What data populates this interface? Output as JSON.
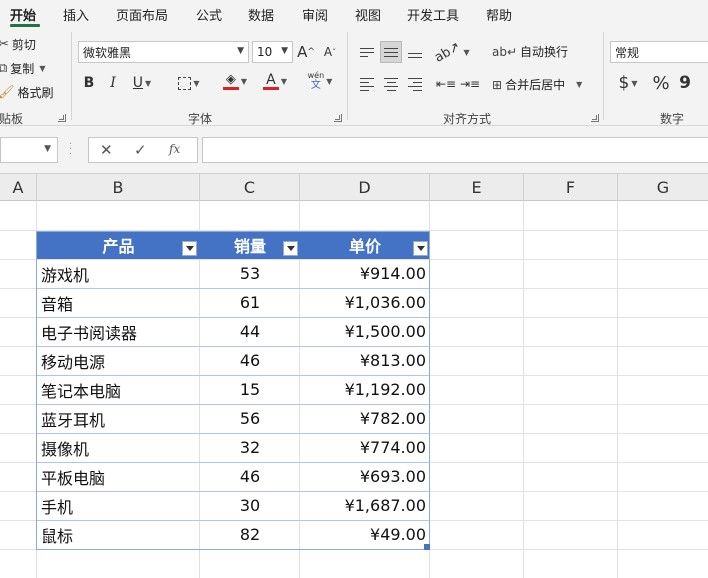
{
  "ribbon_tabs": [
    "开始",
    "插入",
    "页面布局",
    "公式",
    "数据",
    "审阅",
    "视图",
    "开发工具",
    "帮助"
  ],
  "clipboard": {
    "cut": "剪切",
    "copy": "复制",
    "format_painter": "格式刷",
    "group_label": "剪贴板",
    "visible_group_label": "贴板"
  },
  "font": {
    "name": "微软雅黑",
    "size": "10",
    "increase_label": "A",
    "decrease_label": "A",
    "bold": "B",
    "italic": "I",
    "underline": "U",
    "font_color_label": "A",
    "phonetic_top": "wén",
    "phonetic_bottom": "文",
    "group_label": "字体"
  },
  "alignment": {
    "wrap_text": "自动换行",
    "merge_center": "合并后居中",
    "group_label": "对齐方式"
  },
  "number": {
    "format": "常规",
    "currency": "$",
    "percent": "%",
    "comma": "9",
    "group_label": "数字"
  },
  "formula_bar": {
    "fx": "fx",
    "cancel": "✕",
    "enter": "✓"
  },
  "columns": [
    "A",
    "B",
    "C",
    "D",
    "E",
    "F",
    "G"
  ],
  "table": {
    "headers": [
      "产品",
      "销量",
      "单价"
    ],
    "rows": [
      {
        "product": "游戏机",
        "sales": "53",
        "price": "¥914.00"
      },
      {
        "product": "音箱",
        "sales": "61",
        "price": "¥1,036.00"
      },
      {
        "product": "电子书阅读器",
        "sales": "44",
        "price": "¥1,500.00"
      },
      {
        "product": "移动电源",
        "sales": "46",
        "price": "¥813.00"
      },
      {
        "product": "笔记本电脑",
        "sales": "15",
        "price": "¥1,192.00"
      },
      {
        "product": "蓝牙耳机",
        "sales": "56",
        "price": "¥782.00"
      },
      {
        "product": "摄像机",
        "sales": "32",
        "price": "¥774.00"
      },
      {
        "product": "平板电脑",
        "sales": "46",
        "price": "¥693.00"
      },
      {
        "product": "手机",
        "sales": "30",
        "price": "¥1,687.00"
      },
      {
        "product": "鼠标",
        "sales": "82",
        "price": "¥49.00"
      }
    ]
  },
  "colors": {
    "accent": "#217346",
    "table_header": "#4472c4",
    "table_border": "#8ea9db"
  }
}
